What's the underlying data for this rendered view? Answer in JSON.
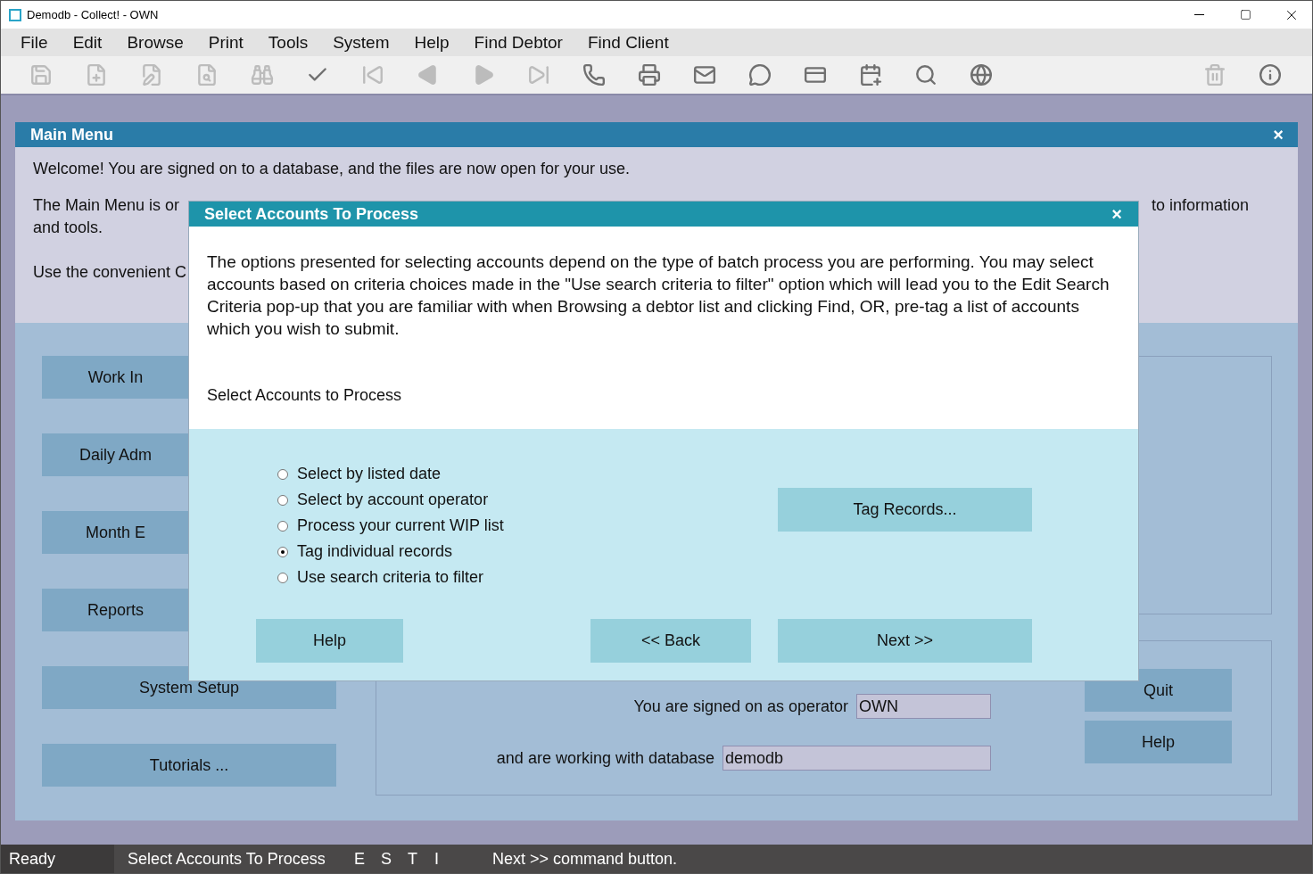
{
  "window": {
    "title": "Demodb - Collect! - OWN"
  },
  "menu": [
    "File",
    "Edit",
    "Browse",
    "Print",
    "Tools",
    "System",
    "Help",
    "Find Debtor",
    "Find Client"
  ],
  "toolbar": [
    {
      "kind": "save",
      "disabled": true
    },
    {
      "kind": "new",
      "disabled": true
    },
    {
      "kind": "edit",
      "disabled": true
    },
    {
      "kind": "find",
      "disabled": true
    },
    {
      "kind": "binoculars",
      "disabled": true
    },
    {
      "kind": "check",
      "disabled": false
    },
    {
      "kind": "first",
      "disabled": true
    },
    {
      "kind": "prev",
      "disabled": true
    },
    {
      "kind": "next",
      "disabled": true
    },
    {
      "kind": "last",
      "disabled": true
    },
    {
      "kind": "phone",
      "disabled": false
    },
    {
      "kind": "print",
      "disabled": false
    },
    {
      "kind": "mail",
      "disabled": false
    },
    {
      "kind": "chat",
      "disabled": false
    },
    {
      "kind": "card",
      "disabled": false
    },
    {
      "kind": "calendar",
      "disabled": false
    },
    {
      "kind": "search",
      "disabled": false
    },
    {
      "kind": "globe",
      "disabled": false
    },
    {
      "kind": "trash",
      "disabled": true
    },
    {
      "kind": "info",
      "disabled": false
    }
  ],
  "main_menu": {
    "title": "Main Menu",
    "close": "×",
    "welcome": "Welcome! You are signed on to a database, and the files are now open for your use.",
    "intro_left": "The Main Menu is or",
    "intro_right": "to information",
    "intro_line2": "and tools.",
    "intro_line3": "Use the convenient C",
    "buttons": [
      "Work In",
      "Daily Adm",
      "Month E",
      "Reports",
      "System Setup",
      "Tutorials ..."
    ],
    "operator_label": "You are signed on as operator",
    "operator": "OWN",
    "database_label": "and are working with database",
    "database": "demodb",
    "side_buttons": [
      "Quit",
      "Help"
    ]
  },
  "dialog": {
    "title": "Select Accounts To Process",
    "close": "×",
    "description": "The options presented for selecting accounts depend on the type of batch process you are performing.  You may select accounts based on criteria choices made in the \"Use search criteria to filter\" option which will lead you to the Edit Search Criteria pop-up that you are familiar with when Browsing a debtor list and clicking Find, OR, pre-tag a list of accounts which you wish to submit.",
    "section_label": "Select Accounts to Process",
    "options": [
      {
        "label": "Select by listed date",
        "selected": false
      },
      {
        "label": "Select by account operator",
        "selected": false
      },
      {
        "label": "Process your current WIP list",
        "selected": false
      },
      {
        "label": "Tag individual records",
        "selected": true
      },
      {
        "label": "Use search criteria to filter",
        "selected": false
      }
    ],
    "tag_button": "Tag Records...",
    "help_button": "Help",
    "back_button": "<< Back",
    "next_button": "Next >>"
  },
  "status_bar": [
    "Ready",
    "Select Accounts To Process",
    "E",
    "S",
    "T",
    "I",
    "Next >> command button."
  ]
}
